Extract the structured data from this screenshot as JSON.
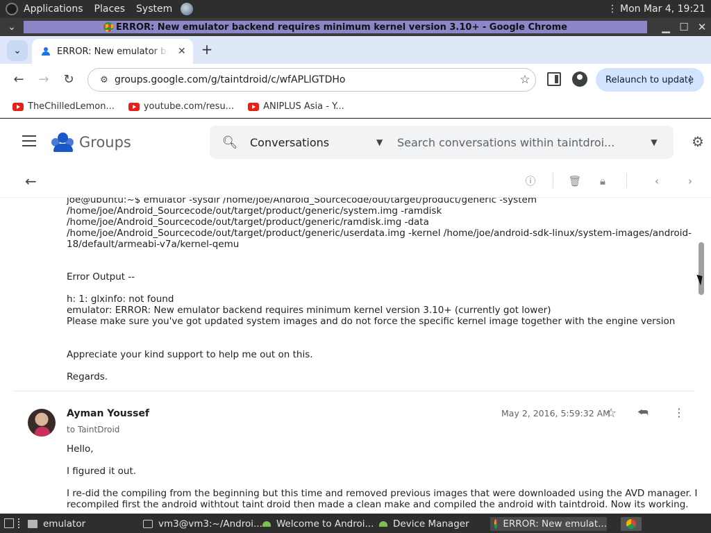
{
  "top_panel": {
    "menus": [
      "Applications",
      "Places",
      "System"
    ],
    "clock": "Mon Mar  4, 19:21"
  },
  "window": {
    "title": "ERROR: New emulator backend requires minimum kernel version 3.10+ - Google Chrome"
  },
  "browser": {
    "tab_title": "ERROR: New emulator backend requires minimum kernel version 3.10+",
    "url": "groups.google.com/g/taintdroid/c/wfAPLlGTDHo",
    "relaunch_label": "Relaunch to update",
    "bookmarks": [
      "TheChilledLemon...",
      "youtube.com/resu...",
      "ANIPLUS Asia - Y..."
    ]
  },
  "groups": {
    "app_name": "Groups",
    "search_scope": "Conversations",
    "search_placeholder": "Search conversations within taintdroi..."
  },
  "thread": {
    "prev_message_lines": [
      "joe@ubuntu:~$ emulator -sysdir /home/joe/Android_Sourcecode/out/target/product/generic -system",
      "/home/joe/Android_Sourcecode/out/target/product/generic/system.img -ramdisk",
      "/home/joe/Android_Sourcecode/out/target/product/generic/ramdisk.img -data",
      "/home/joe/Android_Sourcecode/out/target/product/generic/userdata.img -kernel /home/joe/android-sdk-linux/system-images/android-",
      "18/default/armeabi-v7a/kernel-qemu",
      "Error Output --",
      "h: 1: glxinfo: not found",
      "emulator: ERROR: New emulator backend requires minimum kernel version 3.10+ (currently got lower)",
      "Please make sure you've got updated system images and do not force the specific kernel image together with the engine version",
      "Appreciate your kind support to help me out on this.",
      "Regards."
    ],
    "reply": {
      "author": "Ayman Youssef",
      "to": "to TaintDroid",
      "date": "May 2, 2016, 5:59:32 AM",
      "lines": [
        "Hello,",
        "I figured it out.",
        "I re-did the compiling from the beginning but this time and removed previous images that were downloaded using the AVD manager. I",
        "recompiled first the android withtout taint droid then made a clean make and compiled the android with taintdroid. Now its working."
      ]
    }
  },
  "taskbar": {
    "tasks": [
      "emulator",
      "vm3@vm3:~/Androi...",
      "Welcome to Androi...",
      "Device Manager",
      "ERROR: New emulat..."
    ]
  }
}
